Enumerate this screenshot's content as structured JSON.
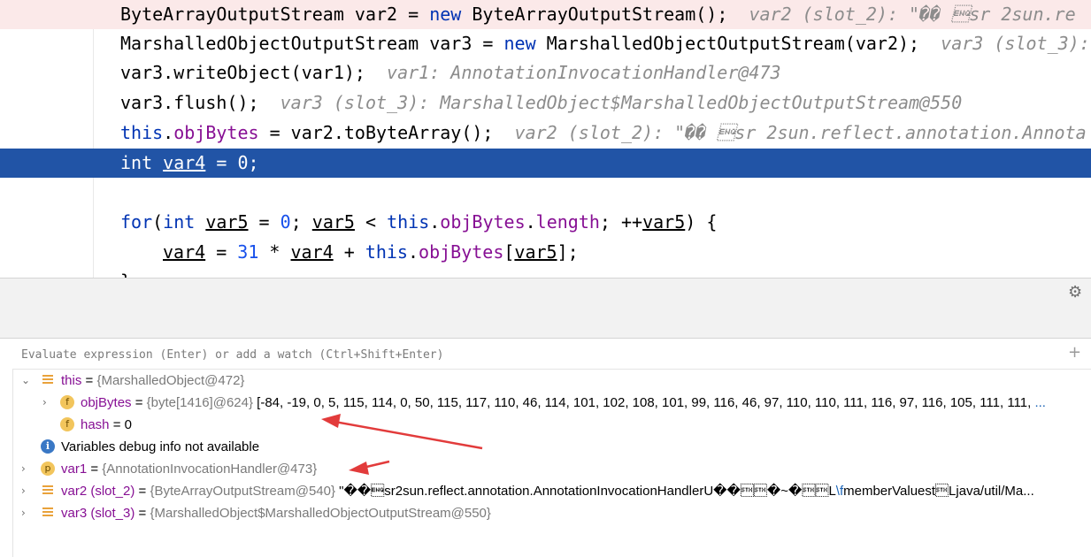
{
  "editor": {
    "lines": [
      {
        "code": "ByteArrayOutputStream var2 = new ByteArrayOutputStream();",
        "hint": "var2 (slot_2): \"�� \u0005sr 2sun.re"
      },
      {
        "code": "MarshalledObjectOutputStream var3 = new MarshalledObjectOutputStream(var2);",
        "hint": "var3 (slot_3):"
      },
      {
        "code": "var3.writeObject(var1);",
        "hint": "var1: AnnotationInvocationHandler@473"
      },
      {
        "code": "var3.flush();",
        "hint": "var3 (slot_3): MarshalledObject$MarshalledObjectOutputStream@550"
      },
      {
        "code": "this.objBytes = var2.toByteArray();",
        "hint": "var2 (slot_2): \"�� \u0005sr 2sun.reflect.annotation.Annota"
      },
      {
        "code": "int var4 = 0;",
        "hint": ""
      },
      {
        "code": "",
        "hint": ""
      },
      {
        "code": "for(int var5 = 0; var5 < this.objBytes.length; ++var5) {",
        "hint": ""
      },
      {
        "code": "var4 = 31 * var4 + this.objBytes[var5];",
        "hint": ""
      }
    ]
  },
  "debugger": {
    "eval_placeholder": "Evaluate expression (Enter) or add a watch (Ctrl+Shift+Enter)",
    "variables": [
      {
        "name": "this",
        "eq": " = ",
        "type": "{MarshalledObject@472}",
        "value": ""
      },
      {
        "name": "objBytes",
        "eq": " = ",
        "type": "{byte[1416]@624}",
        "value": " [-84, -19, 0, 5, 115, 114, 0, 50, 115, 117, 110, 46, 114, 101, 102, 108, 101, 99, 116, 46, 97, 110, 110, 111, 116, 97, 116, 105, 111, 111,",
        "ellipsis": " ..."
      },
      {
        "name": "hash",
        "eq": " = ",
        "type": "",
        "value": "0"
      },
      {
        "name": "Variables debug info not available",
        "eq": "",
        "type": "",
        "value": ""
      },
      {
        "name": "var1",
        "eq": " = ",
        "type": "{AnnotationInvocationHandler@473}",
        "value": ""
      },
      {
        "name": "var2 (slot_2)",
        "eq": " = ",
        "type": "{ByteArrayOutputStream@540}",
        "value": " \"��\u0005sr2sun.reflect.annotation.AnnotationInvocationHandlerU��\u0002\u0002�~�\u0002\u0002L",
        "link": "\\f",
        "value_tail": "memberValuest\u0002Ljava/util/Ma...",
        "ellipsis": ""
      },
      {
        "name": "var3 (slot_3)",
        "eq": " = ",
        "type": "{MarshalledObject$MarshalledObjectOutputStream@550}",
        "value": ""
      }
    ]
  },
  "colors": {
    "exec_line": "#2154a6",
    "tint_line": "#fbe9e9",
    "arrow": "#e23b3b"
  }
}
